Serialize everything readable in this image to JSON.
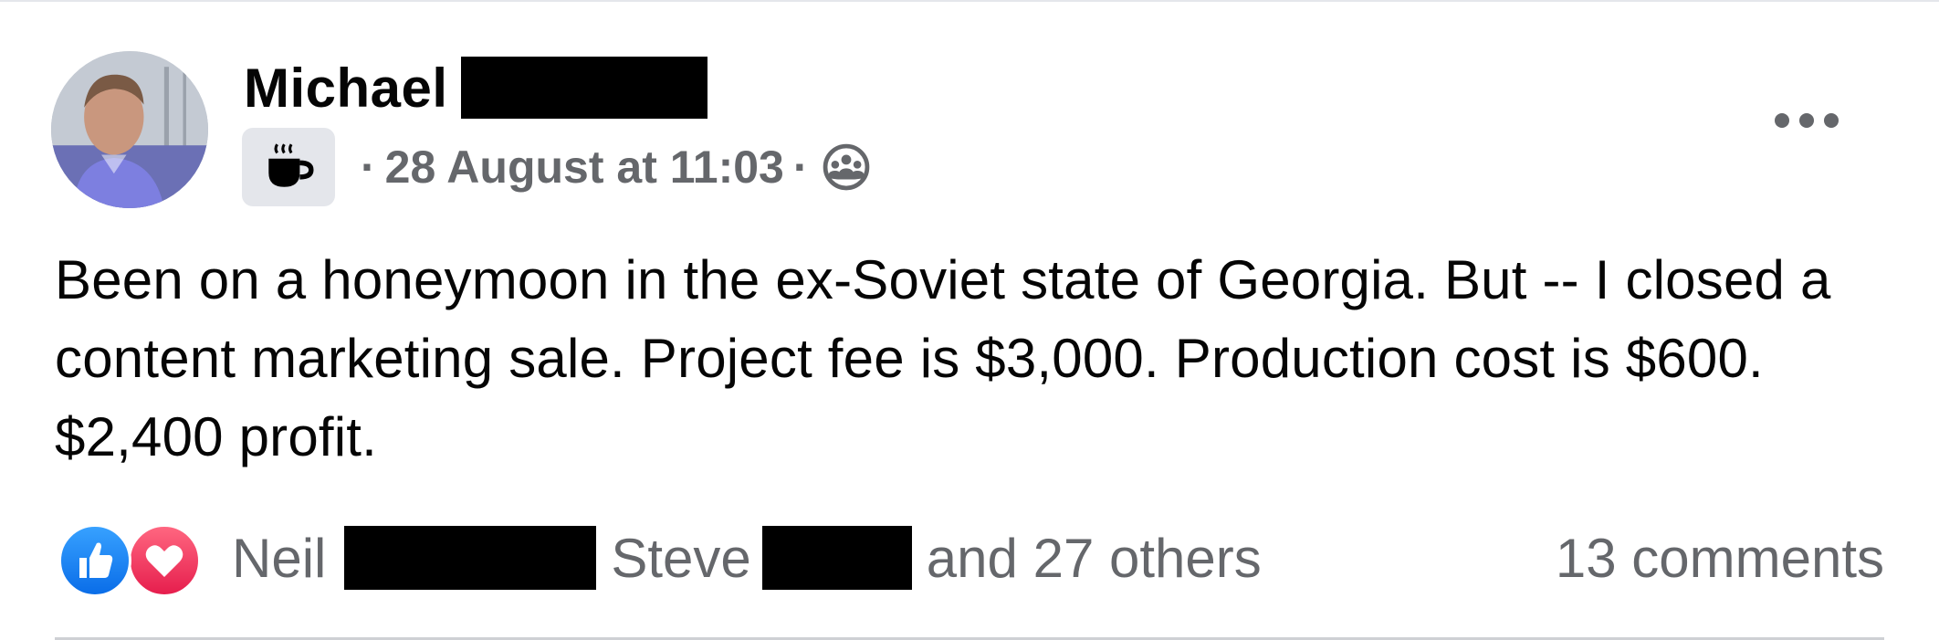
{
  "post": {
    "author": {
      "first_name": "Michael"
    },
    "meta": {
      "separator": "·",
      "timestamp": "28 August at 11:03",
      "badge_icon": "coffee-cup-icon",
      "audience_icon": "group-members-icon"
    },
    "menu_icon": "more-options-icon",
    "text": "Been on a honeymoon in the ex-Soviet state of Georgia. But -- I closed a content marketing sale. Project fee is $3,000. Production cost is $600. $2,400 profit.",
    "reactions": {
      "icons": [
        "like-icon",
        "love-icon"
      ],
      "name_1": "Neil",
      "name_2": "Steve",
      "others": "and 27 others"
    },
    "comments": "13 comments"
  },
  "colors": {
    "secondary_text": "#65676b",
    "primary_text": "#050505",
    "like_blue": "#0a6de8",
    "love_red": "#e61e4d",
    "badge_bg": "#e4e6eb"
  }
}
